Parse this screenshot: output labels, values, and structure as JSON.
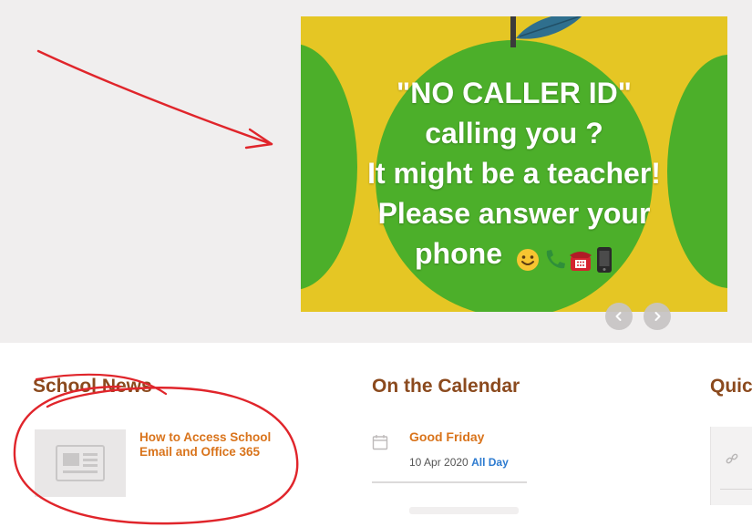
{
  "slide": {
    "lines": [
      "\"NO CALLER ID\"",
      "calling you ?",
      "It might be a teacher!",
      "Please answer your",
      "phone"
    ],
    "emojis": [
      "smiling-face-emoji",
      "telephone-receiver-emoji",
      "telephone-emoji",
      "mobile-phone-emoji"
    ]
  },
  "carousel": {
    "prev_icon": "chevron-left-icon",
    "next_icon": "chevron-right-icon"
  },
  "news": {
    "title": "School News",
    "items": [
      {
        "title": "How to Access School Email and Office 365",
        "thumb_icon": "newspaper-icon"
      }
    ]
  },
  "calendar": {
    "title": "On the Calendar",
    "events": [
      {
        "title": "Good Friday",
        "date": "10 Apr 2020",
        "time": "All Day"
      }
    ]
  },
  "quick": {
    "title": "Quic",
    "icon": "link-icon"
  },
  "colors": {
    "band": "#f0eeee",
    "slide_bg": "#e5c624",
    "slide_green": "#4caf2a",
    "heading": "#8b4a1e",
    "link": "#d9741c",
    "all_day": "#2d7bd0",
    "annotation": "#e0252b"
  }
}
